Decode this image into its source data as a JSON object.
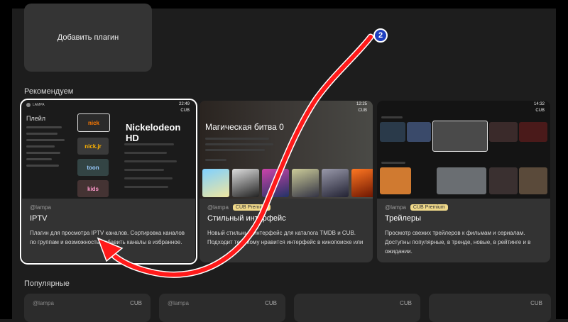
{
  "add_plugin": {
    "label": "Добавить плагин"
  },
  "sections": {
    "recommended": "Рекомендуем",
    "popular": "Популярные"
  },
  "cards": [
    {
      "author": "@lampa",
      "badge": "",
      "title": "IPTV",
      "description": "Плагин для просмотра IPTV каналов. Сортировка каналов по группам и возможность добавить каналы в избранное.",
      "thumb": {
        "app": "LAMPA",
        "time": "22:49",
        "cub": "CUB",
        "sidebar_head": "Плейл",
        "channel_title": "Nickelodeon HD",
        "logos": [
          "nick",
          "nick.jr",
          "toon",
          "kids"
        ]
      }
    },
    {
      "author": "@lampa",
      "badge": "CUB Premium",
      "title": "Стильный интерфейс",
      "description": "Новый стильный интерфейс для каталога TMDB и CUB. Подходит тем, кому нравится интерфейс в кинопоиске или",
      "thumb": {
        "time": "12:25",
        "cub": "CUB",
        "movie_title": "Магическая битва 0"
      }
    },
    {
      "author": "@lampa",
      "badge": "CUB Premium",
      "title": "Трейлеры",
      "description": "Просмотр свежих трейлеров к фильмам и сериалам. Доступны популярные, в тренде, новые, в рейтинге и в ожидании.",
      "thumb": {
        "time": "14:32",
        "cub": "CUB"
      }
    }
  ],
  "popular": [
    {
      "author": "@lampa",
      "cub": "CUB"
    },
    {
      "author": "@lampa",
      "cub": "CUB"
    },
    {
      "author": "",
      "cub": "CUB"
    },
    {
      "author": "",
      "cub": "CUB"
    }
  ],
  "annotation": {
    "marker": "2",
    "marker_color": "#1f3fbf",
    "arrow_color": "#ff1a1a"
  },
  "colors": {
    "background": "#1d1d1d",
    "card": "#333333",
    "badge": "#f0d98a"
  }
}
